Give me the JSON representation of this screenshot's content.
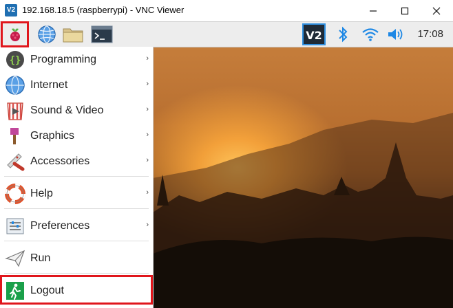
{
  "window": {
    "title": "192.168.18.5 (raspberrypi) - VNC Viewer",
    "app_icon": "vnc-icon"
  },
  "window_controls": [
    "minimize-icon",
    "maximize-icon",
    "close-icon"
  ],
  "taskbar": {
    "launchers": [
      "raspberry-pi-menu-icon",
      "web-browser-icon",
      "file-manager-icon",
      "terminal-icon"
    ],
    "tray": [
      "vnc-server-icon",
      "bluetooth-icon",
      "wifi-icon",
      "volume-icon"
    ],
    "clock": "17:08"
  },
  "menu": {
    "items": [
      {
        "label": "Programming",
        "icon": "programming-icon",
        "submenu": true
      },
      {
        "label": "Internet",
        "icon": "internet-icon",
        "submenu": true
      },
      {
        "label": "Sound & Video",
        "icon": "sound-video-icon",
        "submenu": true
      },
      {
        "label": "Graphics",
        "icon": "graphics-icon",
        "submenu": true
      },
      {
        "label": "Accessories",
        "icon": "accessories-icon",
        "submenu": true
      },
      {
        "label": "Help",
        "icon": "help-icon",
        "submenu": true
      },
      {
        "label": "Preferences",
        "icon": "preferences-icon",
        "submenu": true
      },
      {
        "label": "Run",
        "icon": "run-icon",
        "submenu": false
      },
      {
        "label": "Logout",
        "icon": "logout-icon",
        "submenu": false
      }
    ],
    "submenu_glyph": "›"
  },
  "colors": {
    "highlight": "#e0161c",
    "vnc_blue": "#1f6fb2",
    "tray_blue": "#1e88e5"
  }
}
